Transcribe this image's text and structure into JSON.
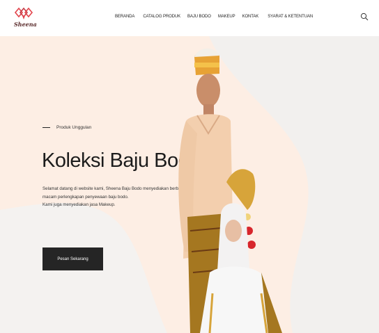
{
  "brand": {
    "name": "Sheena",
    "accent": "#e2434b"
  },
  "nav": {
    "items": [
      {
        "label": "BERANDA"
      },
      {
        "label": "CATALOG PRODUK"
      },
      {
        "label": "BAJU BODO"
      },
      {
        "label": "MAKEUP"
      },
      {
        "label": "KONTAK"
      },
      {
        "label": "SYARAT & KETENTUAN"
      }
    ],
    "search_icon": "search-icon"
  },
  "hero": {
    "kicker": "Produk Unggulan",
    "title": "Koleksi Baju Bodo",
    "desc_line1": "Selamat datang di website kami, Sheena Baju Bodo menyediakan berbagai macam perlengkapan penyewaan baju bodo.",
    "desc_line2": "Kami juga menyediakan jasa Makeup.",
    "cta_label": "Pesan Sekarang",
    "bg_color": "#fdeee4",
    "cta_color": "#252525"
  }
}
